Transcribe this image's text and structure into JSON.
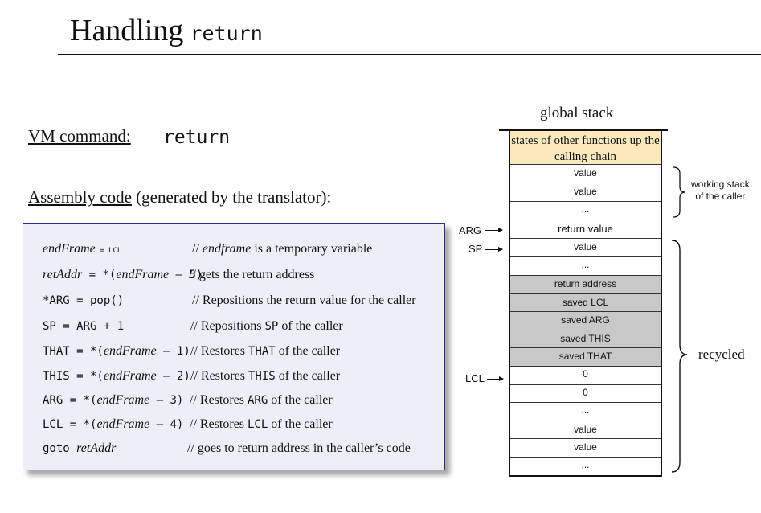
{
  "slide": {
    "title_word": "Handling",
    "title_code": "return"
  },
  "vm": {
    "label": "VM command:",
    "command": "return"
  },
  "assembly": {
    "heading_underlined": "Assembly code",
    "heading_rest": " (generated by the translator):"
  },
  "code": [
    {
      "a": "",
      "b": "endFrame",
      "c": " = LCL",
      "d": "",
      "comment_pre": "// ",
      "comment_em": "endframe",
      "comment_mono": "",
      "comment_post": " is a temporary variable"
    },
    {
      "a": "",
      "b": "retAddr",
      "c": " = *(",
      "d": "endFrame",
      "e": " – 5)",
      "comment_pre": "// gets the return address",
      "comment_em": "",
      "comment_mono": "",
      "comment_post": ""
    },
    {
      "a": "*ARG = pop()",
      "comment_pre": "// Repositions the return value for the caller",
      "comment_em": "",
      "comment_mono": "",
      "comment_post": ""
    },
    {
      "a": "SP = ARG + 1",
      "comment_pre": "// Repositions ",
      "comment_em": "",
      "comment_mono": "SP",
      "comment_post": " of the caller"
    },
    {
      "a": "THAT = *(",
      "d": "endFrame",
      "e": " – 1)",
      "comment_pre": "// Restores ",
      "comment_em": "",
      "comment_mono": "THAT",
      "comment_post": " of the caller"
    },
    {
      "a": "THIS = *(",
      "d": "endFrame",
      "e": " – 2)",
      "comment_pre": "// Restores ",
      "comment_em": "",
      "comment_mono": "THIS",
      "comment_post": " of the caller"
    },
    {
      "a": "ARG = *(",
      "d": "endFrame",
      "e": " – 3)",
      "comment_pre": "// Restores ",
      "comment_em": "",
      "comment_mono": "ARG",
      "comment_post": " of the caller"
    },
    {
      "a": "LCL = *(",
      "d": "endFrame",
      "e": " – 4)",
      "comment_pre": "// Restores ",
      "comment_em": "",
      "comment_mono": "LCL",
      "comment_post": " of the caller"
    },
    {
      "a": "goto ",
      "d": "retAddr",
      "e": "",
      "comment_pre": "// goes to return address in the caller’s code",
      "comment_em": "",
      "comment_mono": "",
      "comment_post": ""
    }
  ],
  "stack": {
    "title": "global stack",
    "cells": [
      "states of other functions up the calling chain",
      "value",
      "value",
      "...",
      "return value",
      "value",
      "...",
      "return address",
      "saved LCL",
      "saved ARG",
      "saved THIS",
      "saved THAT",
      "0",
      "0",
      "...",
      "value",
      "value",
      "..."
    ],
    "pointers": {
      "arg": "ARG",
      "sp": "SP",
      "lcl": "LCL"
    },
    "working_stack_label_1": "working stack",
    "working_stack_label_2": "of the caller",
    "recycled_label": "recycled"
  },
  "colors": {
    "top_cell": "#fbe9bd",
    "saved_cells": "#c8c8c8",
    "code_box_bg": "#eeeef8",
    "code_box_border": "#2a2f7a"
  }
}
